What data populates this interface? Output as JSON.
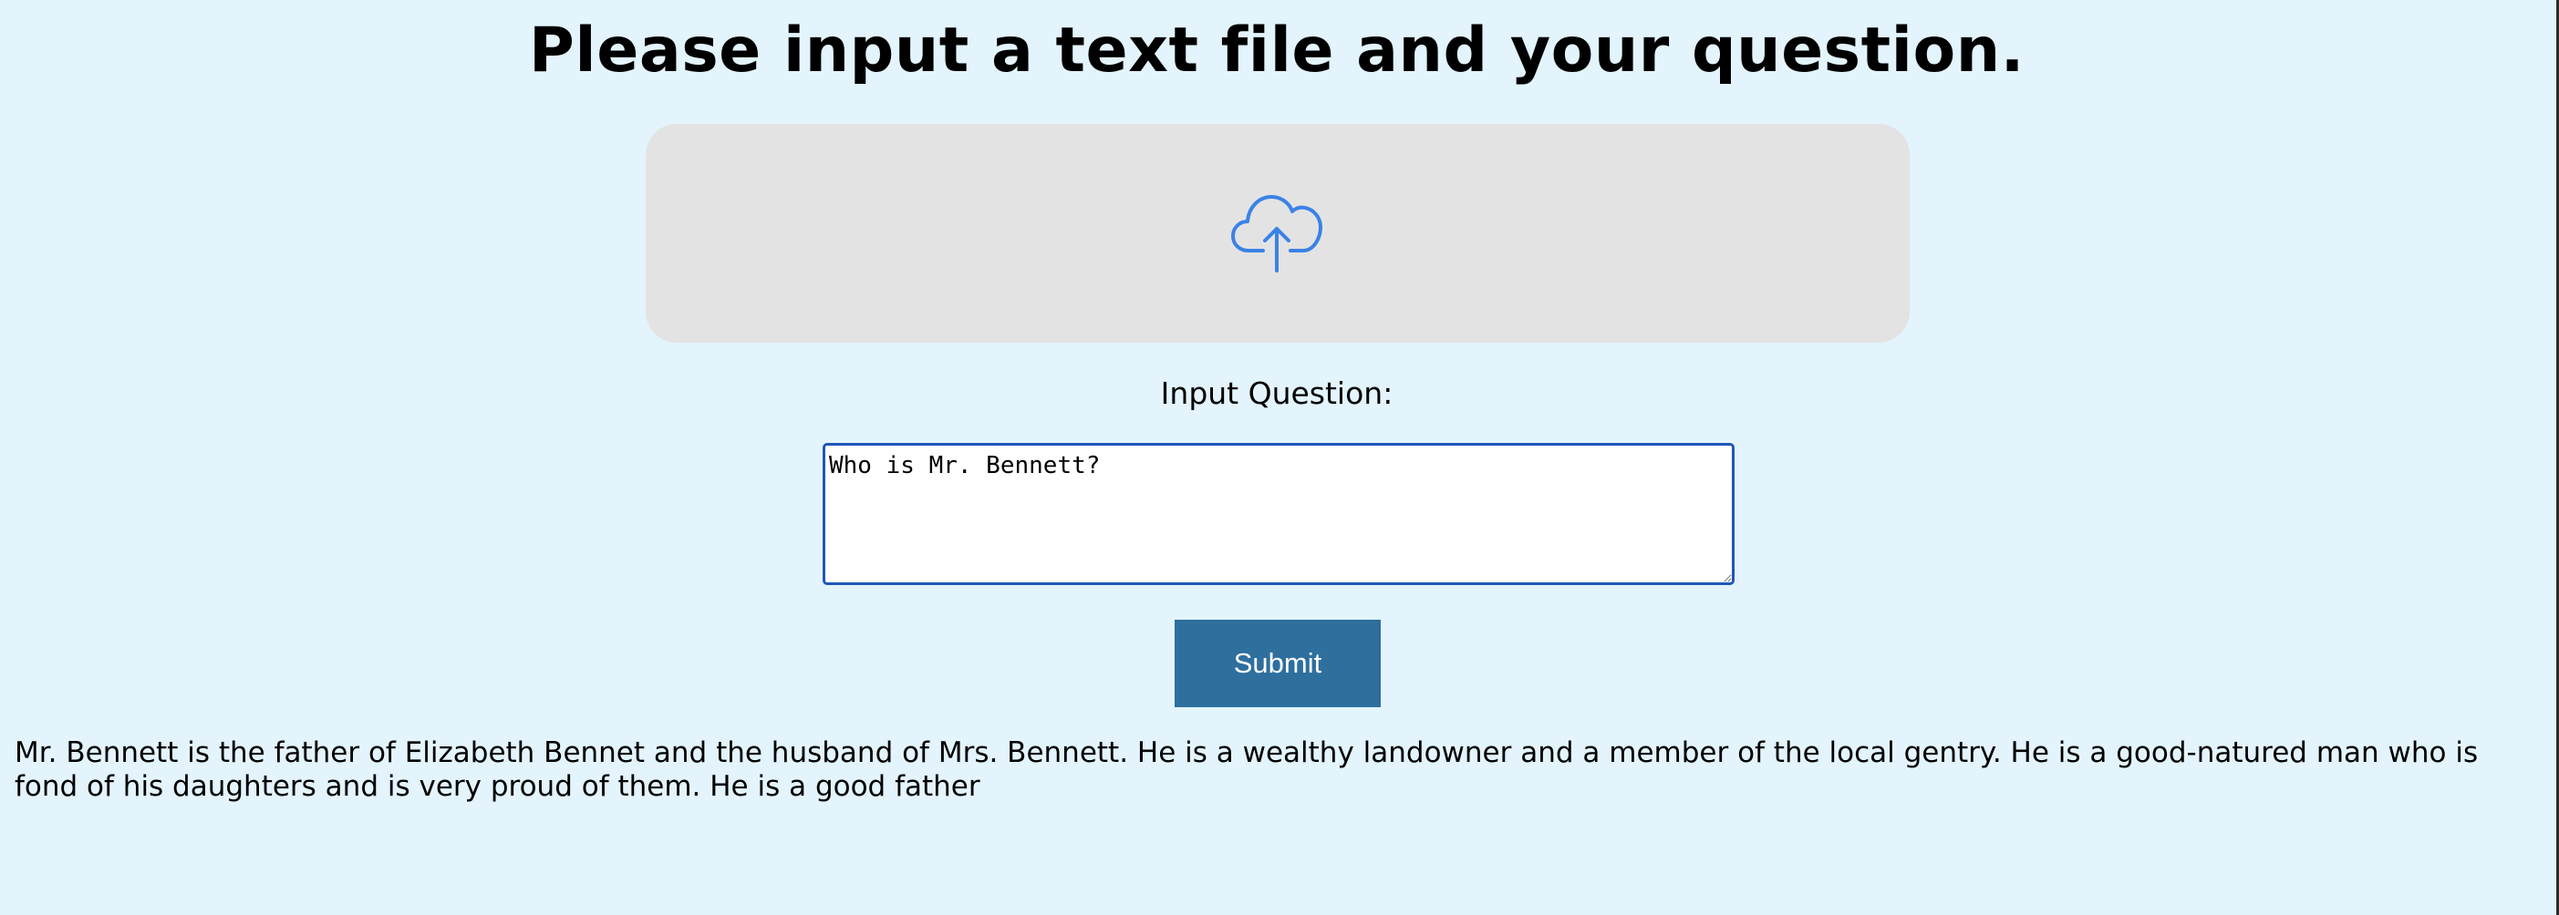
{
  "page": {
    "title": "Please input a text file and your question."
  },
  "upload": {
    "icon": "cloud-upload-icon",
    "icon_color": "#3b82e6"
  },
  "question": {
    "label": "Input Question:",
    "value": "Who is Mr. Bennett?"
  },
  "submit": {
    "label": "Submit"
  },
  "answer": {
    "text": "Mr. Bennett is the father of Elizabeth Bennet and the husband of Mrs. Bennett. He is a wealthy landowner and a member of the local gentry. He is a good-natured man who is fond of his daughters and is very proud of them. He is a good father"
  },
  "colors": {
    "background": "#e3f4fc",
    "upload_zone": "#e3e3e3",
    "submit_button": "#2e6f9e",
    "input_border": "#1f57b8"
  }
}
